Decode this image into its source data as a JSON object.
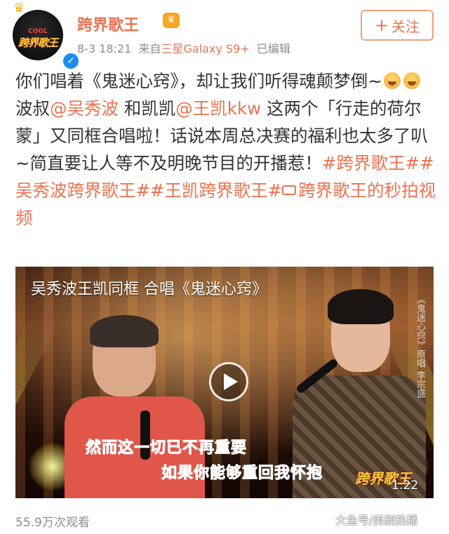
{
  "header": {
    "avatar_mini": "COOL",
    "avatar_logo": "跨界歌王",
    "username": "跨界歌王",
    "date": "8-3 18:21",
    "source_prefix": "来自",
    "source": "三星Galaxy S9+",
    "edited": "已编辑",
    "follow_label": "关注"
  },
  "post": {
    "t1": "你们唱着《鬼迷心窍》，却让我们听得魂颠梦倒~",
    "t2": "波叔",
    "m1": "@吴秀波",
    "t3": " 和凯凯",
    "m2": "@王凯kkw",
    "t4": " 这两个「行走的荷尔蒙」又同框合唱啦！话说本周总决赛的福利也太多了叭~简直要让人等不及明晚节目的开播惹！",
    "tag1": "#跨界歌王#",
    "tag2": "#吴秀波跨界歌王#",
    "tag3": "#王凯跨界歌王#",
    "link": "跨界歌王的秒拍视频"
  },
  "video": {
    "title": "吴秀波王凯同框 合唱《鬼迷心窍》",
    "side_lyric": "《鬼迷心窍》原唱 李宗盛",
    "subtitle1": "然而这一切已不再重要",
    "subtitle2": "如果你能够重回我怀抱",
    "show_logo": "跨界歌王",
    "duration": "1:22"
  },
  "views": "55.9万次观看",
  "watermark": "大鱼号/美剧热播",
  "colors": {
    "accent": "#eb7350",
    "verified": "#1a8df0",
    "meta": "#8e8e8e"
  }
}
